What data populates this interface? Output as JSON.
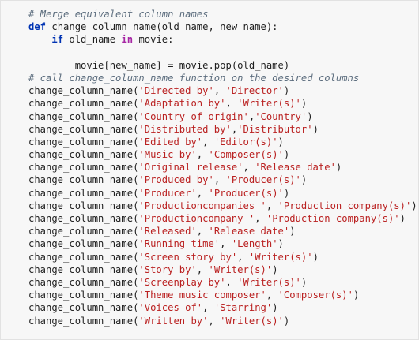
{
  "cell": {
    "lines": [
      {
        "type": "comment",
        "indent": "",
        "text": "# Merge equivalent column names"
      },
      {
        "type": "def",
        "kw": "def",
        "rest": " change_column_name(old_name, new_name):"
      },
      {
        "type": "if",
        "indent": "    ",
        "kw": "if",
        "mid": " old_name ",
        "kw2": "in",
        "rest": " movie:"
      },
      {
        "type": "blank"
      },
      {
        "type": "plain",
        "indent": "        ",
        "text": "movie[new_name] = movie.pop(old_name)"
      },
      {
        "type": "comment",
        "indent": "",
        "text": "# call change_column_name function on the desired columns"
      },
      {
        "type": "call",
        "fn": "change_column_name",
        "a": "'Directed by'",
        "sep": ", ",
        "b": "'Director'"
      },
      {
        "type": "call",
        "fn": "change_column_name",
        "a": "'Adaptation by'",
        "sep": ", ",
        "b": "'Writer(s)'"
      },
      {
        "type": "call",
        "fn": "change_column_name",
        "a": "'Country of origin'",
        "sep": ",",
        "b": "'Country'"
      },
      {
        "type": "call",
        "fn": "change_column_name",
        "a": "'Distributed by'",
        "sep": ",",
        "b": "'Distributor'"
      },
      {
        "type": "call",
        "fn": "change_column_name",
        "a": "'Edited by'",
        "sep": ", ",
        "b": "'Editor(s)'"
      },
      {
        "type": "call",
        "fn": "change_column_name",
        "a": "'Music by'",
        "sep": ", ",
        "b": "'Composer(s)'"
      },
      {
        "type": "call",
        "fn": "change_column_name",
        "a": "'Original release'",
        "sep": ", ",
        "b": "'Release date'"
      },
      {
        "type": "call",
        "fn": "change_column_name",
        "a": "'Produced by'",
        "sep": ", ",
        "b": "'Producer(s)'"
      },
      {
        "type": "call",
        "fn": "change_column_name",
        "a": "'Producer'",
        "sep": ", ",
        "b": "'Producer(s)'"
      },
      {
        "type": "call",
        "fn": "change_column_name",
        "a": "'Productioncompanies '",
        "sep": ", ",
        "b": "'Production company(s)'"
      },
      {
        "type": "call",
        "fn": "change_column_name",
        "a": "'Productioncompany '",
        "sep": ", ",
        "b": "'Production company(s)'"
      },
      {
        "type": "call",
        "fn": "change_column_name",
        "a": "'Released'",
        "sep": ", ",
        "b": "'Release date'"
      },
      {
        "type": "call",
        "fn": "change_column_name",
        "a": "'Running time'",
        "sep": ", ",
        "b": "'Length'"
      },
      {
        "type": "call",
        "fn": "change_column_name",
        "a": "'Screen story by'",
        "sep": ", ",
        "b": "'Writer(s)'"
      },
      {
        "type": "call",
        "fn": "change_column_name",
        "a": "'Story by'",
        "sep": ", ",
        "b": "'Writer(s)'"
      },
      {
        "type": "call",
        "fn": "change_column_name",
        "a": "'Screenplay by'",
        "sep": ", ",
        "b": "'Writer(s)'"
      },
      {
        "type": "call",
        "fn": "change_column_name",
        "a": "'Theme music composer'",
        "sep": ", ",
        "b": "'Composer(s)'"
      },
      {
        "type": "call",
        "fn": "change_column_name",
        "a": "'Voices of'",
        "sep": ", ",
        "b": "'Starring'"
      },
      {
        "type": "call",
        "fn": "change_column_name",
        "a": "'Written by'",
        "sep": ", ",
        "b": "'Writer(s)'"
      }
    ]
  },
  "colors": {
    "background": "#f7f7f7",
    "keyword": "#0033b3",
    "operator_keyword": "#a626a4",
    "comment": "#5c6d7e",
    "string": "#ba2121",
    "text": "#1f1f1f"
  }
}
